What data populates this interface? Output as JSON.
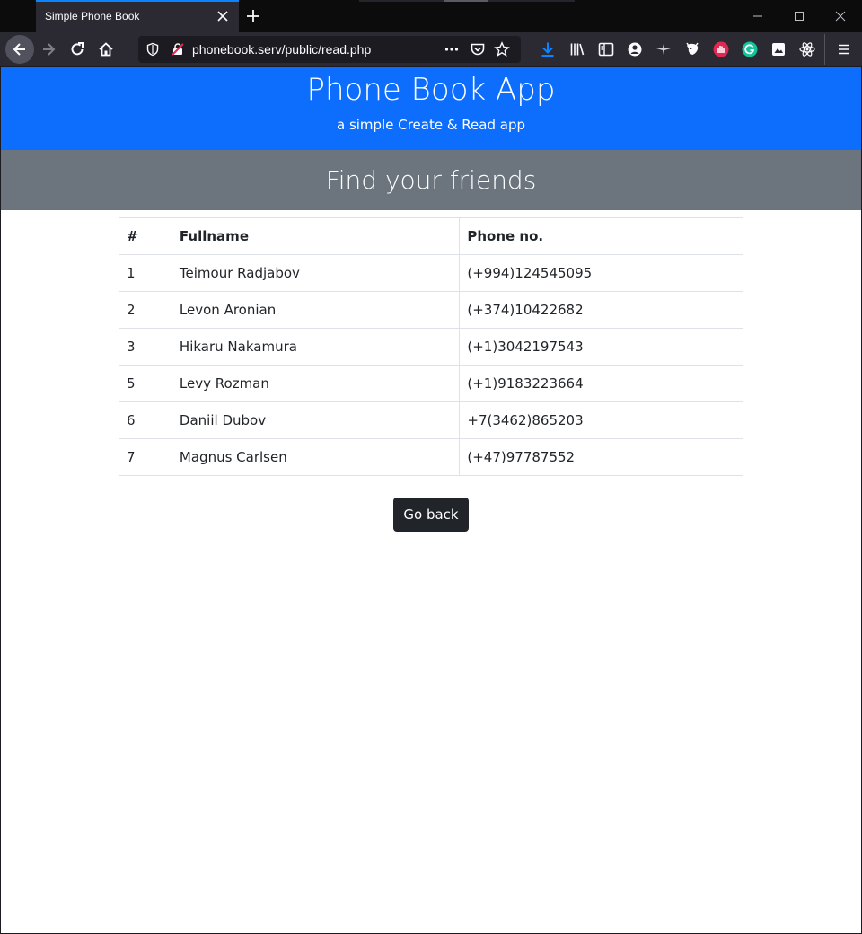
{
  "browser": {
    "tab_title": "Simple Phone Book",
    "url": "phonebook.serv/public/read.php"
  },
  "hero": {
    "title": "Phone Book App",
    "subtitle": "a simple Create & Read app"
  },
  "section": {
    "title": "Find your friends"
  },
  "table": {
    "headers": [
      "#",
      "Fullname",
      "Phone no."
    ],
    "rows": [
      [
        "1",
        "Teimour Radjabov",
        "(+994)124545095"
      ],
      [
        "2",
        "Levon Aronian",
        "(+374)10422682"
      ],
      [
        "3",
        "Hikaru Nakamura",
        "(+1)3042197543"
      ],
      [
        "5",
        "Levy Rozman",
        "(+1)9183223664"
      ],
      [
        "6",
        "Daniil Dubov",
        "+7(3462)865203"
      ],
      [
        "7",
        "Magnus Carlsen",
        "(+47)97787552"
      ]
    ]
  },
  "actions": {
    "go_back": "Go back"
  },
  "colors": {
    "primary": "#0d6efd",
    "secondary": "#6c757d",
    "dark": "#212529"
  }
}
